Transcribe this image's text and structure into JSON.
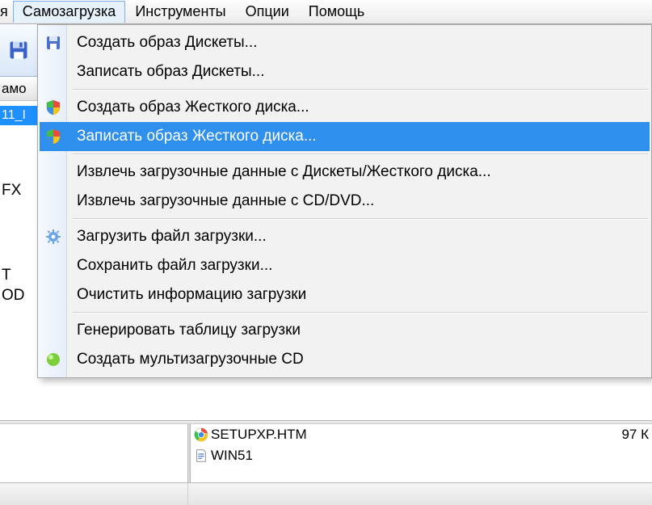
{
  "menubar": {
    "remnant": "я",
    "items": [
      "Самозагрузка",
      "Инструменты",
      "Опции",
      "Помощь"
    ],
    "open_index": 0
  },
  "leftcol": {
    "bootable_label": "амо",
    "selected_label": "11_I",
    "fx": "FX",
    "t": "T",
    "od": "OD"
  },
  "dropdown": {
    "items": [
      {
        "label": "Создать образ Дискеты...",
        "icon": "floppy-icon"
      },
      {
        "label": "Записать образ Дискеты...",
        "icon": ""
      },
      {
        "sep": true
      },
      {
        "label": "Создать образ Жесткого диска...",
        "icon": "shield-icon"
      },
      {
        "label": "Записать образ Жесткого диска...",
        "icon": "shield-icon",
        "highlight": true
      },
      {
        "sep": true
      },
      {
        "label": "Извлечь загрузочные данные с Дискеты/Жесткого диска...",
        "icon": ""
      },
      {
        "label": "Извлечь загрузочные данные с CD/DVD...",
        "icon": ""
      },
      {
        "sep": true
      },
      {
        "label": "Загрузить файл загрузки...",
        "icon": "gear-icon"
      },
      {
        "label": "Сохранить файл загрузки...",
        "icon": ""
      },
      {
        "label": "Очистить информацию загрузки",
        "icon": ""
      },
      {
        "sep": true
      },
      {
        "label": "Генерировать таблицу загрузки",
        "icon": ""
      },
      {
        "label": "Создать мультизагрузочные CD",
        "icon": "green-dot-icon"
      }
    ]
  },
  "files": {
    "rows": [
      {
        "name": "SETUPXP.HTM",
        "icon": "chrome-icon",
        "size": "97 К"
      },
      {
        "name": "WIN51",
        "icon": "file-icon",
        "size": ""
      }
    ]
  }
}
